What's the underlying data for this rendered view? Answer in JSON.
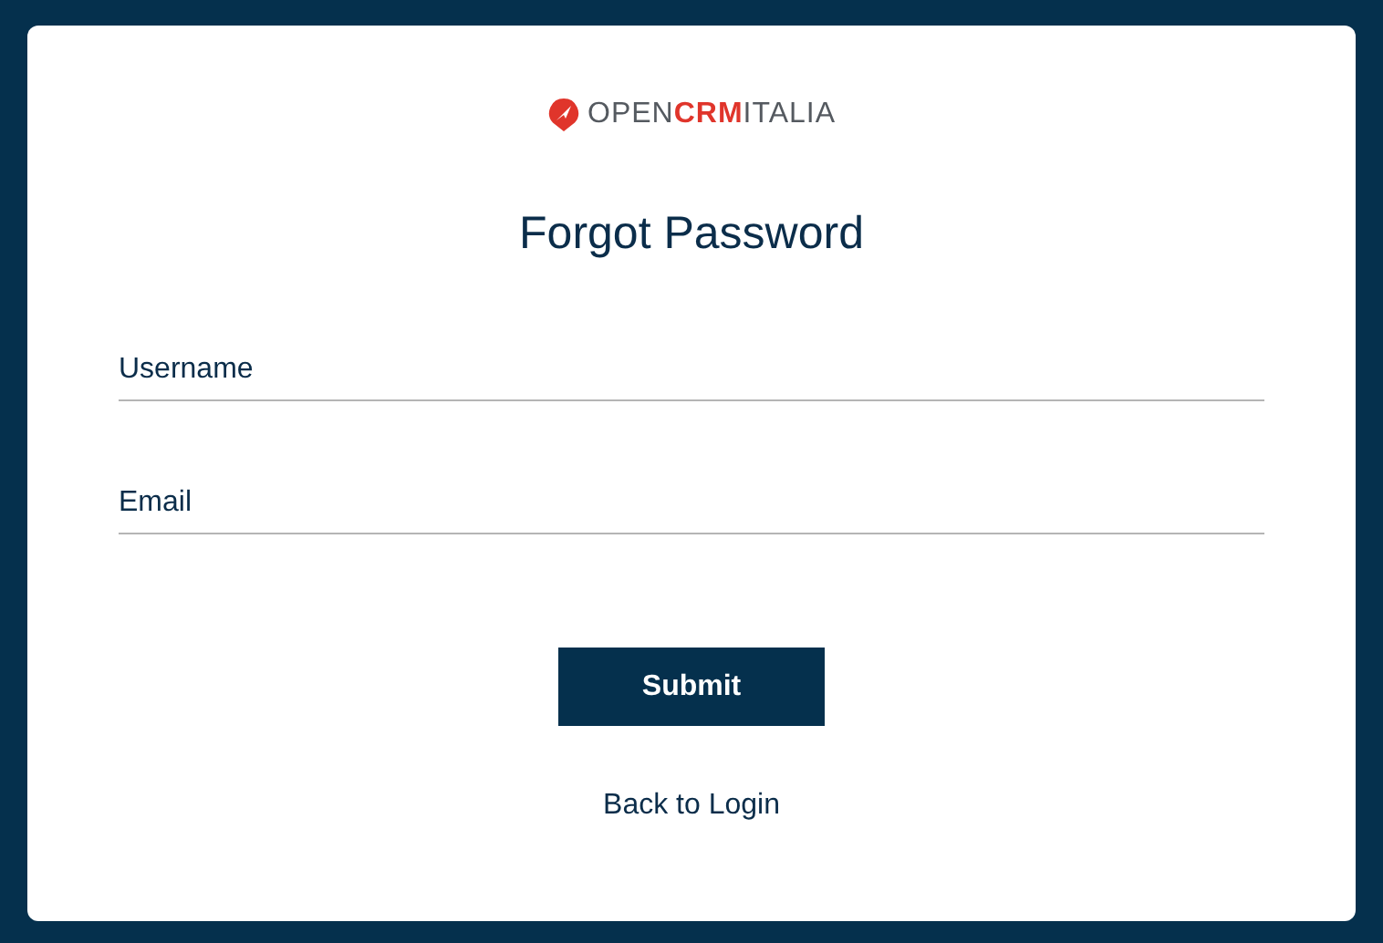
{
  "logo": {
    "parts": [
      {
        "text": "OPEN",
        "kind": "plain"
      },
      {
        "text": "CRM",
        "kind": "accent"
      },
      {
        "text": "ITALIA",
        "kind": "plain"
      }
    ]
  },
  "title": "Forgot Password",
  "fields": [
    {
      "placeholder": "Username"
    },
    {
      "placeholder": "Email"
    }
  ],
  "submit": "Submit",
  "back_link": "Back to Login"
}
